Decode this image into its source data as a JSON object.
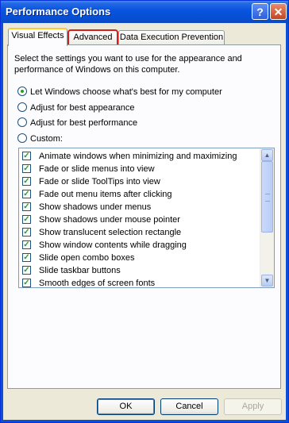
{
  "window": {
    "title": "Performance Options"
  },
  "titlebar_buttons": {
    "help": "?",
    "close": "✕"
  },
  "tabs": [
    {
      "label": "Visual Effects",
      "active": true
    },
    {
      "label": "Advanced",
      "active": false,
      "highlighted": true
    },
    {
      "label": "Data Execution Prevention",
      "active": false
    }
  ],
  "description": "Select the settings you want to use for the appearance and performance of Windows on this computer.",
  "options": [
    {
      "label": "Let Windows choose what's best for my computer",
      "selected": true
    },
    {
      "label": "Adjust for best appearance",
      "selected": false
    },
    {
      "label": "Adjust for best performance",
      "selected": false
    },
    {
      "label": "Custom:",
      "selected": false
    }
  ],
  "effects": [
    {
      "label": "Animate windows when minimizing and maximizing",
      "checked": true
    },
    {
      "label": "Fade or slide menus into view",
      "checked": true
    },
    {
      "label": "Fade or slide ToolTips into view",
      "checked": true
    },
    {
      "label": "Fade out menu items after clicking",
      "checked": true
    },
    {
      "label": "Show shadows under menus",
      "checked": true
    },
    {
      "label": "Show shadows under mouse pointer",
      "checked": true
    },
    {
      "label": "Show translucent selection rectangle",
      "checked": true
    },
    {
      "label": "Show window contents while dragging",
      "checked": true
    },
    {
      "label": "Slide open combo boxes",
      "checked": true
    },
    {
      "label": "Slide taskbar buttons",
      "checked": true
    },
    {
      "label": "Smooth edges of screen fonts",
      "checked": true
    }
  ],
  "buttons": {
    "ok": "OK",
    "cancel": "Cancel",
    "apply": "Apply"
  },
  "colors": {
    "title_bar": "#0a55e0",
    "highlight_box": "#d21f1f",
    "check": "#21a121"
  }
}
